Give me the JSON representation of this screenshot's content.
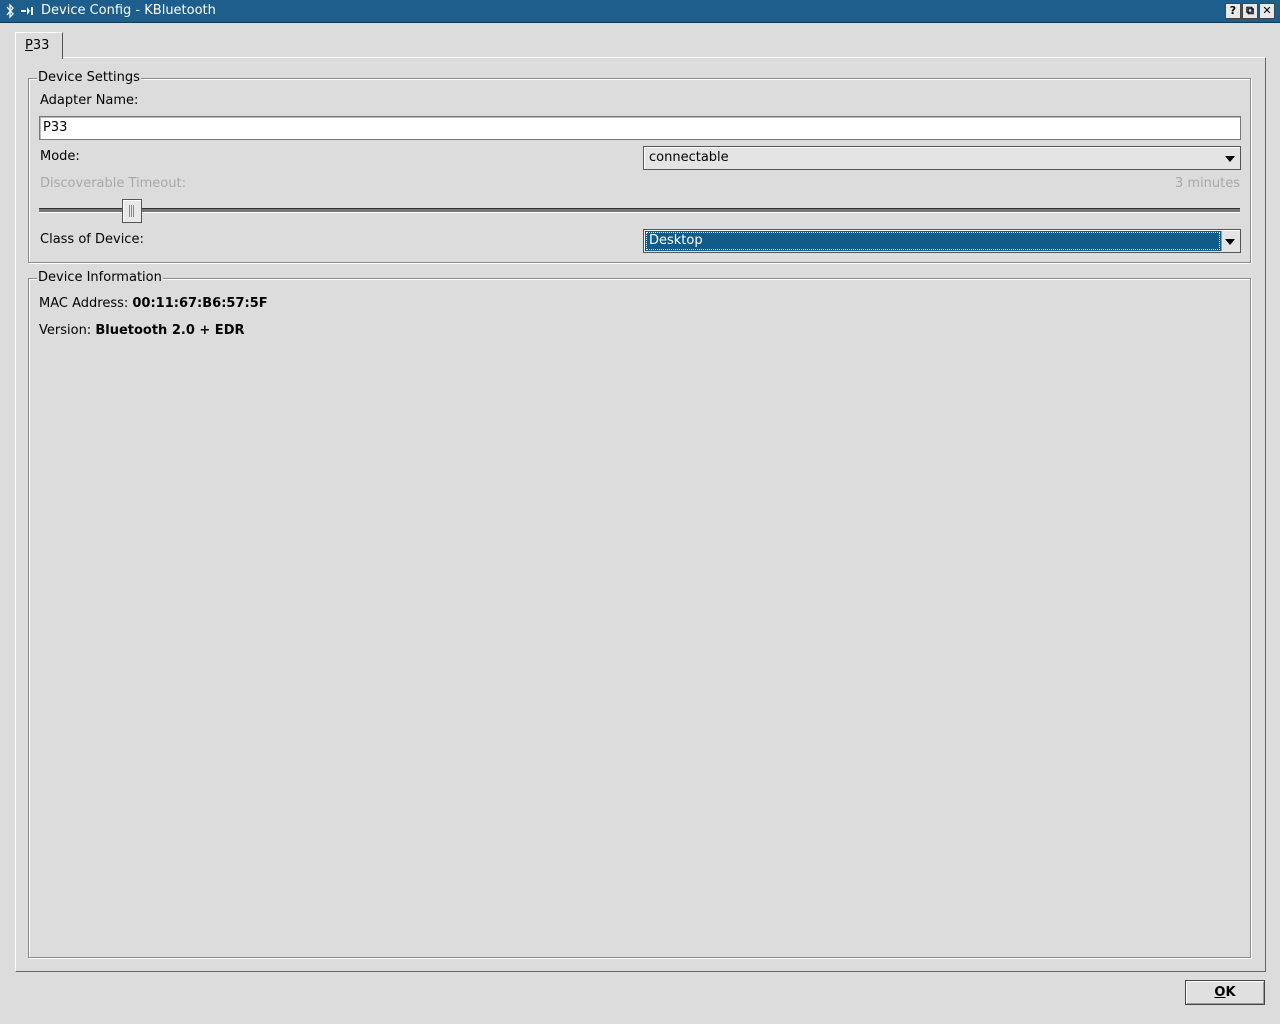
{
  "window": {
    "title": "Device Config - KBluetooth",
    "help_label": "?",
    "maximize_label": "⧉",
    "close_label": "✕"
  },
  "tab": {
    "label": "P33",
    "mnemonic": "P"
  },
  "device_settings": {
    "title": "Device Settings",
    "adapter_name_label": "Adapter Name:",
    "adapter_name_value": "P33",
    "mode_label": "Mode:",
    "mode_value": "connectable",
    "timeout_label": "Discoverable Timeout:",
    "timeout_value": "3 minutes",
    "timeout_slider_fraction": 0.07,
    "class_label": "Class of Device:",
    "class_value": "Desktop"
  },
  "device_info": {
    "title": "Device Information",
    "mac_label": "MAC Address:",
    "mac_value": "00:11:67:B6:57:5F",
    "version_label": "Version:",
    "version_value": "Bluetooth 2.0 + EDR"
  },
  "buttons": {
    "ok_label": "OK"
  },
  "colors": {
    "titlebar": "#1d5e8d",
    "selection": "#0f5c8b",
    "background": "#dcdcdc"
  }
}
